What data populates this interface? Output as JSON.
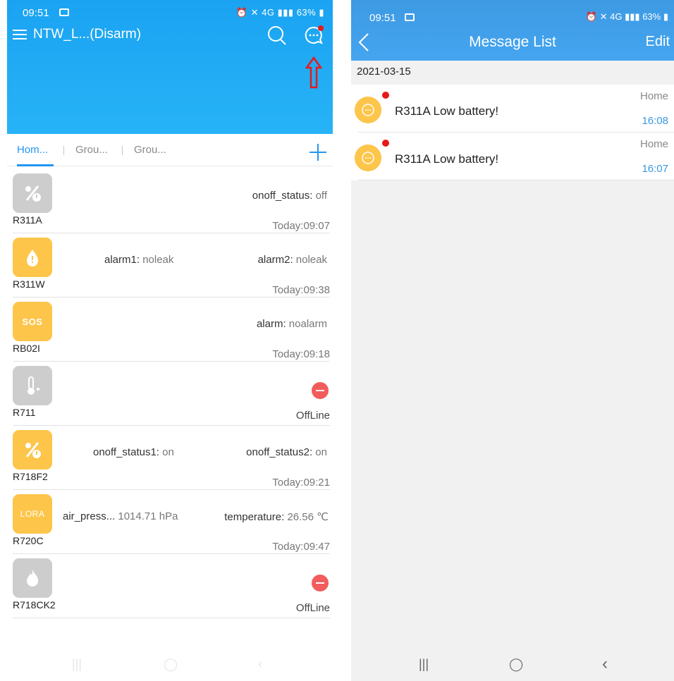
{
  "left": {
    "status": {
      "time": "09:51",
      "battery": "63%"
    },
    "toolbar": {
      "title": "NTW_L...(Disarm)"
    },
    "tabs": [
      "Hom...",
      "Grou...",
      "Grou..."
    ],
    "devices": [
      {
        "name": "R311A",
        "icon": "percent-switch-icon",
        "color": "gray",
        "fields": [
          {
            "k": "onoff_status:",
            "v": " off"
          }
        ],
        "time": "Today:09:07"
      },
      {
        "name": "R311W",
        "icon": "water-leak-icon",
        "color": "yellow",
        "fields": [
          {
            "k": "alarm1:",
            "v": " noleak"
          },
          {
            "k": "alarm2:",
            "v": " noleak"
          }
        ],
        "time": "Today:09:38"
      },
      {
        "name": "RB02I",
        "icon": "sos-icon",
        "iconText": "SOS",
        "color": "yellow",
        "fields": [
          {
            "k": "alarm:",
            "v": " noalarm"
          }
        ],
        "time": "Today:09:18"
      },
      {
        "name": "R711",
        "icon": "thermometer-icon",
        "color": "gray",
        "fields": [],
        "offline": "OffLine"
      },
      {
        "name": "R718F2",
        "icon": "percent-switch-icon",
        "color": "yellow",
        "fields": [
          {
            "k": "onoff_status1:",
            "v": " on"
          },
          {
            "k": "onoff_status2:",
            "v": " on"
          }
        ],
        "time": "Today:09:21"
      },
      {
        "name": "R720C",
        "icon": "lora-icon",
        "iconText": "LORA",
        "color": "yellow",
        "fields": [
          {
            "k": "air_press...",
            "v": " 1014.71 hPa"
          },
          {
            "k": "temperature:",
            "v": " 26.56 ℃"
          }
        ],
        "time": "Today:09:47"
      },
      {
        "name": "R718CK2",
        "icon": "fire-icon",
        "color": "gray",
        "fields": [],
        "offline": "OffLine"
      }
    ]
  },
  "right": {
    "status": {
      "time": "09:51",
      "battery": "63%"
    },
    "title": "Message List",
    "edit": "Edit",
    "date": "2021-03-15",
    "messages": [
      {
        "text": "R311A Low battery!",
        "group": "Home",
        "time": "16:08"
      },
      {
        "text": "R311A Low battery!",
        "group": "Home",
        "time": "16:07"
      }
    ]
  },
  "colors": {
    "accent": "#2196f3",
    "header": "#1aa3f2",
    "iconYellow": "#fdc54a",
    "iconGray": "#cdcdcd",
    "alert": "#e81919"
  }
}
